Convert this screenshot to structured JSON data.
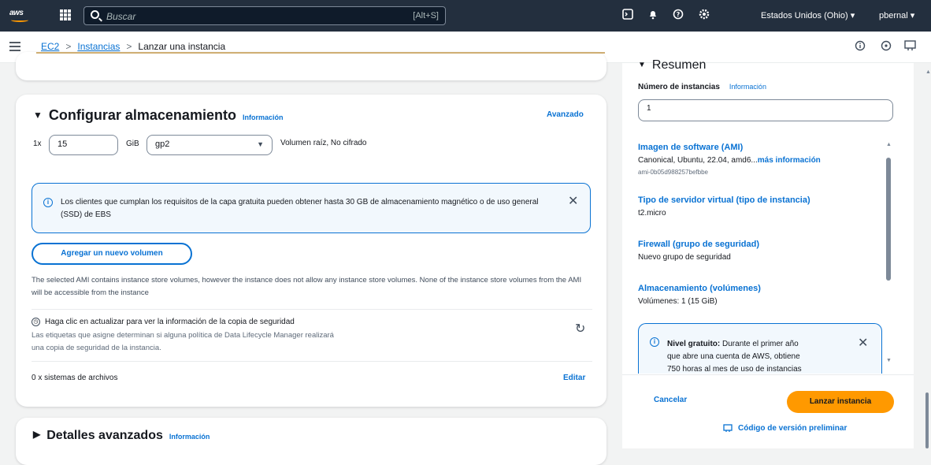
{
  "topbar": {
    "logo": "aws",
    "search_placeholder": "Buscar",
    "search_shortcut": "[Alt+S]",
    "region": "Estados Unidos (Ohio) ▾",
    "user": "pbernal ▾",
    "icons": [
      "cloudshell-icon",
      "bell-icon",
      "help-icon",
      "settings-icon"
    ]
  },
  "breadcrumb": {
    "items": [
      "EC2",
      "Instancias",
      "Lanzar una instancia"
    ],
    "separator": ">"
  },
  "storage": {
    "title": "Configurar almacenamiento",
    "info_link": "Información",
    "advanced_link": "Avanzado",
    "multiplier": "1x",
    "size_value": "15",
    "unit": "GiB",
    "volume_type": "gp2",
    "volume_desc": "Volumen raíz,  No cifrado",
    "free_tier_alert": "Los clientes que cumplan los requisitos de la capa gratuita pueden obtener hasta 30 GB de almacenamiento magnético o de uso general (SSD) de EBS",
    "add_volume_button": "Agregar un nuevo volumen",
    "instance_store_note": "The selected AMI contains instance store volumes, however the instance does not allow any instance store volumes. None of the instance store volumes from the AMI will be accessible from the instance",
    "backup_title": "Haga clic en actualizar para ver la información de la copia de seguridad",
    "backup_desc_1": "Las etiquetas que asigne determinan si alguna política de Data Lifecycle Manager realizará",
    "backup_desc_2": "una copia de seguridad de la instancia.",
    "filesystems": "0 x sistemas de archivos",
    "edit_link": "Editar"
  },
  "advanced": {
    "title": "Detalles avanzados",
    "info_link": "Información"
  },
  "summary": {
    "title": "Resumen",
    "instances_label": "Número de instancias",
    "instances_info": "Información",
    "instances_value": "1",
    "ami_label": "Imagen de software (AMI)",
    "ami_value": "Canonical, Ubuntu, 22.04, amd6...",
    "ami_more": "más información",
    "ami_id": "ami-0b05d988257befbbe",
    "type_label": "Tipo de servidor virtual (tipo de instancia)",
    "type_value": "t2.micro",
    "firewall_label": "Firewall (grupo de seguridad)",
    "firewall_value": "Nuevo grupo de seguridad",
    "storage_label": "Almacenamiento (volúmenes)",
    "storage_value": "Volúmenes: 1 (15 GiB)",
    "free_tier_bold": "Nivel gratuito:",
    "free_tier_text_1": "Durante el primer año",
    "free_tier_text_2": "que abre una cuenta de AWS, obtiene",
    "free_tier_text_3": "750 horas al mes de uso de instancias",
    "cancel": "Cancelar",
    "launch": "Lanzar instancia",
    "preview_code": "Código de versión preliminar"
  },
  "colors": {
    "topbar_bg": "#232f3e",
    "link": "#0972d3",
    "primary_button": "#ff9900",
    "info_bg": "#f2f8fd"
  }
}
